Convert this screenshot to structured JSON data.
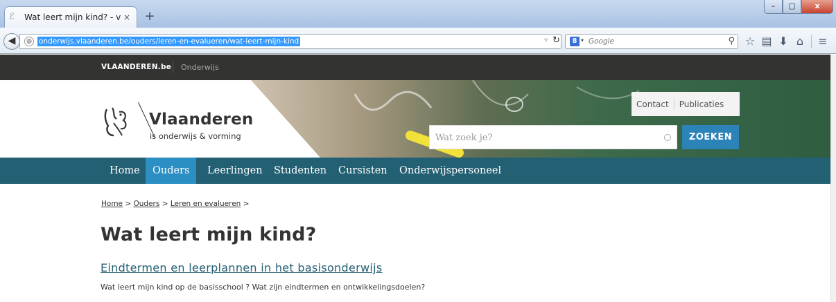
{
  "browser": {
    "tab_title": "Wat leert mijn kind? - voor ...",
    "tab_close": "×",
    "new_tab": "+",
    "url": "onderwijs.vlaanderen.be/ouders/leren-en-evalueren/wat-leert-mijn-kind",
    "search_engine_badge": "8",
    "search_placeholder": "Google",
    "window_buttons": {
      "minimize": "–",
      "maximize": "▢",
      "close": "x"
    }
  },
  "site": {
    "top_brand": "VLAANDEREN.be",
    "top_sub": "Onderwijs",
    "logo_title": "Vlaanderen",
    "logo_subtitle": "is onderwijs & vorming",
    "header_links": [
      "Contact",
      "Publicaties"
    ],
    "search_placeholder": "Wat zoek je?",
    "search_button": "ZOEKEN",
    "nav": [
      {
        "label": "Home",
        "active": false
      },
      {
        "label": "Ouders",
        "active": true
      },
      {
        "label": "Leerlingen",
        "active": false
      },
      {
        "label": "Studenten",
        "active": false
      },
      {
        "label": "Cursisten",
        "active": false
      },
      {
        "label": "Onderwijspersoneel",
        "active": false
      }
    ]
  },
  "content": {
    "breadcrumb": [
      "Home",
      "Ouders",
      "Leren en evalueren"
    ],
    "breadcrumb_sep": ">",
    "title": "Wat leert mijn kind?",
    "section_link": "Eindtermen en leerplannen in het basisonderwijs",
    "section_desc": "Wat leert mijn kind op de basisschool ? Wat zijn eindtermen en ontwikkelingsdoelen?"
  },
  "colors": {
    "nav_bg": "#246073",
    "nav_active": "#2c8fc4",
    "search_button": "#2c83b8",
    "top_strip": "#333332"
  }
}
